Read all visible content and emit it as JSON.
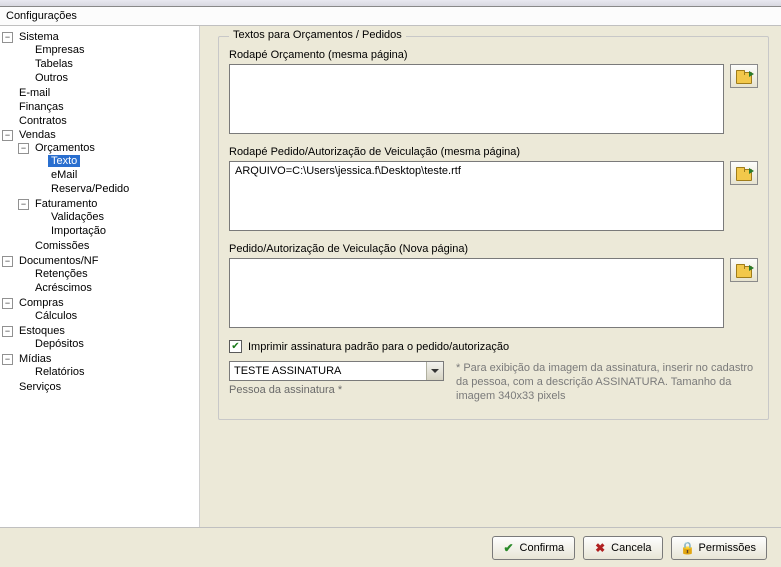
{
  "header": {
    "title": "Configurações"
  },
  "tree": {
    "sistema": "Sistema",
    "empresas": "Empresas",
    "tabelas": "Tabelas",
    "outros": "Outros",
    "email": "E-mail",
    "financas": "Finanças",
    "contratos": "Contratos",
    "vendas": "Vendas",
    "orcamentos": "Orçamentos",
    "texto": "Texto",
    "vendas_email": "eMail",
    "reserva_pedido": "Reserva/Pedido",
    "faturamento": "Faturamento",
    "validacoes": "Validações",
    "importacao": "Importação",
    "comissoes": "Comissões",
    "documentos_nf": "Documentos/NF",
    "retencoes": "Retenções",
    "acrescimos": "Acréscimos",
    "compras": "Compras",
    "calculos": "Cálculos",
    "estoques": "Estoques",
    "depositos": "Depósitos",
    "midias": "Mídias",
    "relatorios": "Relatórios",
    "servicos": "Serviços"
  },
  "panel": {
    "group_title": "Textos para Orçamentos / Pedidos",
    "rodape_orcamento_label": "Rodapé Orçamento (mesma página)",
    "rodape_orcamento_value": "",
    "rodape_pedido_label": "Rodapé Pedido/Autorização de Veiculação (mesma página)",
    "rodape_pedido_value": "ARQUIVO=C:\\Users\\jessica.f\\Desktop\\teste.rtf",
    "pedido_nova_label": "Pedido/Autorização de Veiculação (Nova página)",
    "pedido_nova_value": "",
    "checkbox_label": "Imprimir assinatura padrão para o pedido/autorização",
    "checkbox_checked": true,
    "combo_value": "TESTE ASSINATURA",
    "combo_sublabel": "Pessoa da assinatura *",
    "hint": "* Para exibição da imagem da assinatura, inserir no cadastro da pessoa, com a descrição ASSINATURA.\nTamanho da imagem 340x33 pixels"
  },
  "buttons": {
    "confirma": "Confirma",
    "cancela": "Cancela",
    "permissoes": "Permissões"
  }
}
